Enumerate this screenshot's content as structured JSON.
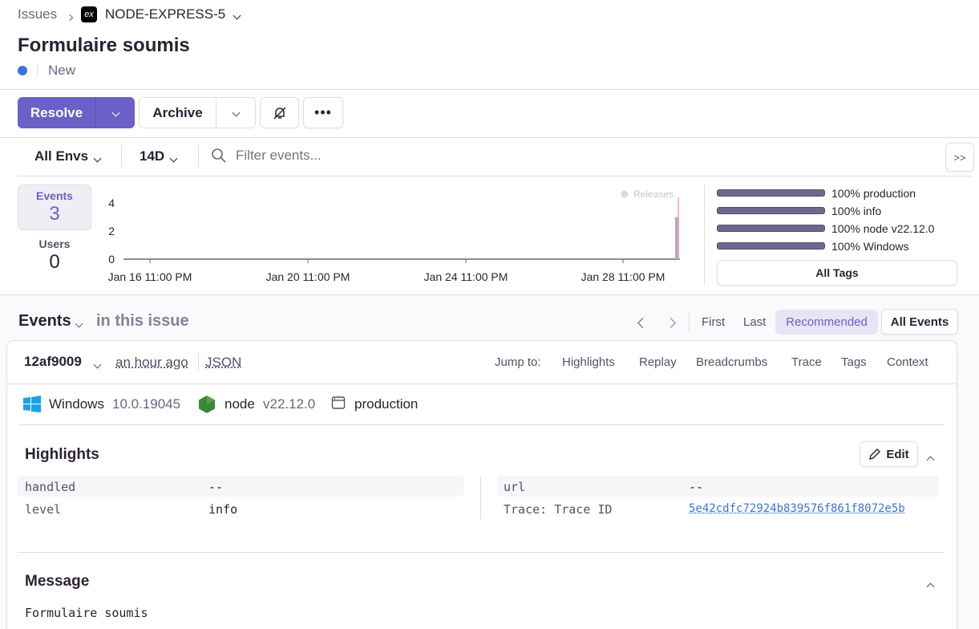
{
  "breadcrumb": {
    "issues": "Issues",
    "project": "NODE-EXPRESS-5",
    "project_icon": "ex"
  },
  "issue": {
    "title": "Formulaire soumis",
    "status": "New",
    "status_color": "#3d74db"
  },
  "actions": {
    "resolve": "Resolve",
    "archive": "Archive"
  },
  "filters": {
    "env": "All Envs",
    "period": "14D",
    "search_placeholder": "Filter events..."
  },
  "stats": {
    "events_label": "Events",
    "events_value": "3",
    "users_label": "Users",
    "users_value": "0"
  },
  "chart_data": {
    "type": "bar",
    "x": [
      "Jan 16 11:00 PM",
      "Jan 20 11:00 PM",
      "Jan 24 11:00 PM",
      "Jan 28 11:00 PM"
    ],
    "series": [
      {
        "values": [
          0,
          0,
          0,
          3
        ]
      }
    ],
    "y_ticks": [
      "4",
      "2",
      "0"
    ],
    "ylim": [
      0,
      4
    ],
    "legend": "Releases",
    "bar_color": "#b4aac4",
    "release_color": "#f2a0c6"
  },
  "tags": [
    {
      "label": "100% production",
      "percent": 100
    },
    {
      "label": "100% info",
      "percent": 100
    },
    {
      "label": "100% node v22.12.0",
      "percent": 100
    },
    {
      "label": "100% Windows",
      "percent": 100
    }
  ],
  "all_tags": "All Tags",
  "events_header": {
    "title": "Events",
    "subtitle": "in this issue",
    "first": "First",
    "last": "Last",
    "recommended": "Recommended",
    "all_events": "All Events"
  },
  "event": {
    "id": "12af9009",
    "time": "an hour ago",
    "json": "JSON",
    "jump_to": "Jump to:",
    "jump_links": [
      "Highlights",
      "Replay",
      "Breadcrumbs",
      "Trace",
      "Tags",
      "Context"
    ],
    "os_name": "Windows",
    "os_version": "10.0.19045",
    "runtime_name": "node",
    "runtime_version": "v22.12.0",
    "environment": "production"
  },
  "highlights": {
    "title": "Highlights",
    "edit": "Edit",
    "left": [
      {
        "key": "handled",
        "value": "--"
      },
      {
        "key": "level",
        "value": "info"
      }
    ],
    "right": [
      {
        "key": "url",
        "value": "--"
      },
      {
        "key": "Trace: Trace ID",
        "value": "5e42cdfc72924b839576f861f8072e5b"
      }
    ]
  },
  "message": {
    "title": "Message",
    "body": "Formulaire soumis"
  }
}
